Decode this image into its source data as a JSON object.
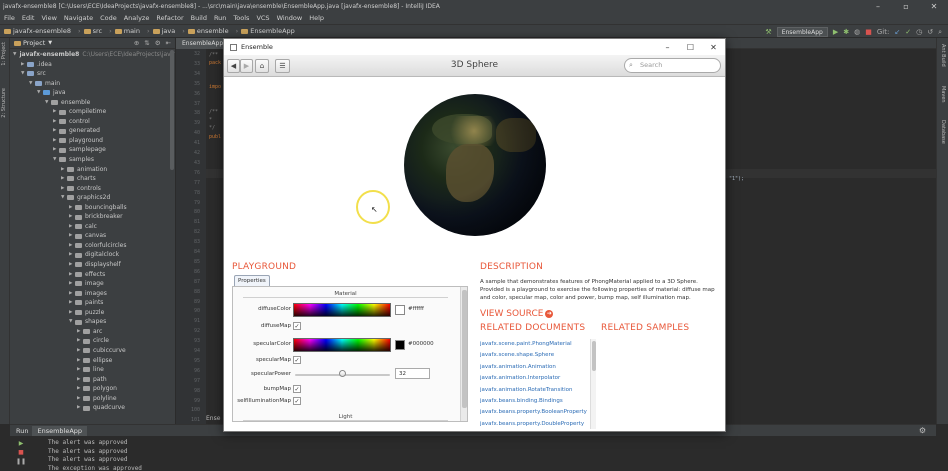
{
  "ide": {
    "title": "javafx-ensemble8 [C:\\Users\\ECE\\IdeaProjects\\javafx-ensemble8] - ...\\src\\main\\java\\ensemble\\EnsembleApp.java [javafx-ensemble8] - IntelliJ IDEA",
    "menu": [
      "File",
      "Edit",
      "View",
      "Navigate",
      "Code",
      "Analyze",
      "Refactor",
      "Build",
      "Run",
      "Tools",
      "VCS",
      "Window",
      "Help"
    ],
    "breadcrumbs": [
      "javafx-ensemble8",
      "src",
      "main",
      "java",
      "ensemble",
      "EnsembleApp"
    ],
    "run_config": "EnsembleApp",
    "git_label": "Git:",
    "left_tabs": [
      "1: Project",
      "2: Structure"
    ],
    "right_tabs": [
      "Ant Build",
      "Maven",
      "Database"
    ],
    "project_header": "Project",
    "editor_tab": "EnsembleApp.java",
    "editor_foot": "Ense",
    "line_numbers": [
      "32",
      "33",
      "34",
      "35",
      "36",
      "37",
      "38",
      "39",
      "40",
      "41",
      "42",
      "43",
      "76",
      "77",
      "78",
      "79",
      "80",
      "81",
      "82",
      "83",
      "84",
      "85",
      "86",
      "87",
      "88",
      "89",
      "90",
      "91",
      "92",
      "93",
      "94",
      "95",
      "96",
      "97",
      "98",
      "99",
      "100",
      "101"
    ],
    "code_tokens": {
      "pack": "pack",
      "impo": "impo",
      "comment1": "/**",
      "comment2": " * ",
      "comment3": " */",
      "publ": "publ",
      "tail": "\"1\");"
    }
  },
  "tree": [
    {
      "label": "javafx-ensemble8",
      "path": "C:\\Users\\ECE\\IdeaProjects\\javafx-e",
      "depth": 0,
      "open": true,
      "kind": "root"
    },
    {
      "label": ".idea",
      "depth": 1,
      "open": false,
      "kind": "folder"
    },
    {
      "label": "src",
      "depth": 1,
      "open": true,
      "kind": "folder"
    },
    {
      "label": "main",
      "depth": 2,
      "open": true,
      "kind": "folder"
    },
    {
      "label": "java",
      "depth": 3,
      "open": true,
      "kind": "src"
    },
    {
      "label": "ensemble",
      "depth": 4,
      "open": true,
      "kind": "pkg"
    },
    {
      "label": "compiletime",
      "depth": 5,
      "open": false,
      "kind": "pkg"
    },
    {
      "label": "control",
      "depth": 5,
      "open": false,
      "kind": "pkg"
    },
    {
      "label": "generated",
      "depth": 5,
      "open": false,
      "kind": "pkg"
    },
    {
      "label": "playground",
      "depth": 5,
      "open": false,
      "kind": "pkg"
    },
    {
      "label": "samplepage",
      "depth": 5,
      "open": false,
      "kind": "pkg"
    },
    {
      "label": "samples",
      "depth": 5,
      "open": true,
      "kind": "pkg"
    },
    {
      "label": "animation",
      "depth": 6,
      "open": false,
      "kind": "pkg"
    },
    {
      "label": "charts",
      "depth": 6,
      "open": false,
      "kind": "pkg"
    },
    {
      "label": "controls",
      "depth": 6,
      "open": false,
      "kind": "pkg"
    },
    {
      "label": "graphics2d",
      "depth": 6,
      "open": true,
      "kind": "pkg"
    },
    {
      "label": "bouncingballs",
      "depth": 7,
      "open": false,
      "kind": "pkg"
    },
    {
      "label": "brickbreaker",
      "depth": 7,
      "open": false,
      "kind": "pkg"
    },
    {
      "label": "calc",
      "depth": 7,
      "open": false,
      "kind": "pkg"
    },
    {
      "label": "canvas",
      "depth": 7,
      "open": false,
      "kind": "pkg"
    },
    {
      "label": "colorfulcircles",
      "depth": 7,
      "open": false,
      "kind": "pkg"
    },
    {
      "label": "digitalclock",
      "depth": 7,
      "open": false,
      "kind": "pkg"
    },
    {
      "label": "displayshelf",
      "depth": 7,
      "open": false,
      "kind": "pkg"
    },
    {
      "label": "effects",
      "depth": 7,
      "open": false,
      "kind": "pkg"
    },
    {
      "label": "image",
      "depth": 7,
      "open": false,
      "kind": "pkg"
    },
    {
      "label": "images",
      "depth": 7,
      "open": false,
      "kind": "pkg"
    },
    {
      "label": "paints",
      "depth": 7,
      "open": false,
      "kind": "pkg"
    },
    {
      "label": "puzzle",
      "depth": 7,
      "open": false,
      "kind": "pkg"
    },
    {
      "label": "shapes",
      "depth": 7,
      "open": true,
      "kind": "pkg"
    },
    {
      "label": "arc",
      "depth": 8,
      "open": false,
      "kind": "pkg"
    },
    {
      "label": "circle",
      "depth": 8,
      "open": false,
      "kind": "pkg"
    },
    {
      "label": "cubiccurve",
      "depth": 8,
      "open": false,
      "kind": "pkg"
    },
    {
      "label": "ellipse",
      "depth": 8,
      "open": false,
      "kind": "pkg"
    },
    {
      "label": "line",
      "depth": 8,
      "open": false,
      "kind": "pkg"
    },
    {
      "label": "path",
      "depth": 8,
      "open": false,
      "kind": "pkg"
    },
    {
      "label": "polygon",
      "depth": 8,
      "open": false,
      "kind": "pkg"
    },
    {
      "label": "polyline",
      "depth": 8,
      "open": false,
      "kind": "pkg"
    },
    {
      "label": "quadcurve",
      "depth": 8,
      "open": false,
      "kind": "pkg"
    }
  ],
  "run": {
    "label": "Run",
    "tab": "EnsembleApp",
    "log": [
      "The alert was approved",
      "The alert was approved",
      "The alert was approved",
      "The exception was approved"
    ]
  },
  "ensemble": {
    "window_title": "Ensemble",
    "page_title": "3D Sphere",
    "search_placeholder": "Search",
    "playground_title": "PLAYGROUND",
    "properties_tab": "Properties",
    "material_label": "Material",
    "light_label": "Light",
    "properties": [
      {
        "name": "diffuseColor",
        "type": "color",
        "value": "#ffffff",
        "swatch": "#ffffff"
      },
      {
        "name": "diffuseMap",
        "type": "check",
        "checked": true
      },
      {
        "name": "specularColor",
        "type": "color",
        "value": "#000000",
        "swatch": "#000000"
      },
      {
        "name": "specularMap",
        "type": "check",
        "checked": true
      },
      {
        "name": "specularPower",
        "type": "slider",
        "value": "32"
      },
      {
        "name": "bumpMap",
        "type": "check",
        "checked": true
      },
      {
        "name": "selfIlluminationMap",
        "type": "check",
        "checked": true
      }
    ],
    "description_title": "DESCRIPTION",
    "description": "A sample that demonstrates features of PhongMaterial applied to a 3D Sphere. Provided is a playground to exercise the following properties of material: diffuse map and color, specular map, color and power, bump map, self illumination map.",
    "view_source": "VIEW SOURCE",
    "related_docs_title": "RELATED DOCUMENTS",
    "related_samples_title": "RELATED SAMPLES",
    "related_docs": [
      "javafx.scene.paint.PhongMaterial",
      "javafx.scene.shape.Sphere",
      "javafx.animation.Animation",
      "javafx.animation.Interpolator",
      "javafx.animation.RotateTransition",
      "javafx.beans.binding.Bindings",
      "javafx.beans.property.BooleanProperty",
      "javafx.beans.property.DoubleProperty"
    ]
  }
}
